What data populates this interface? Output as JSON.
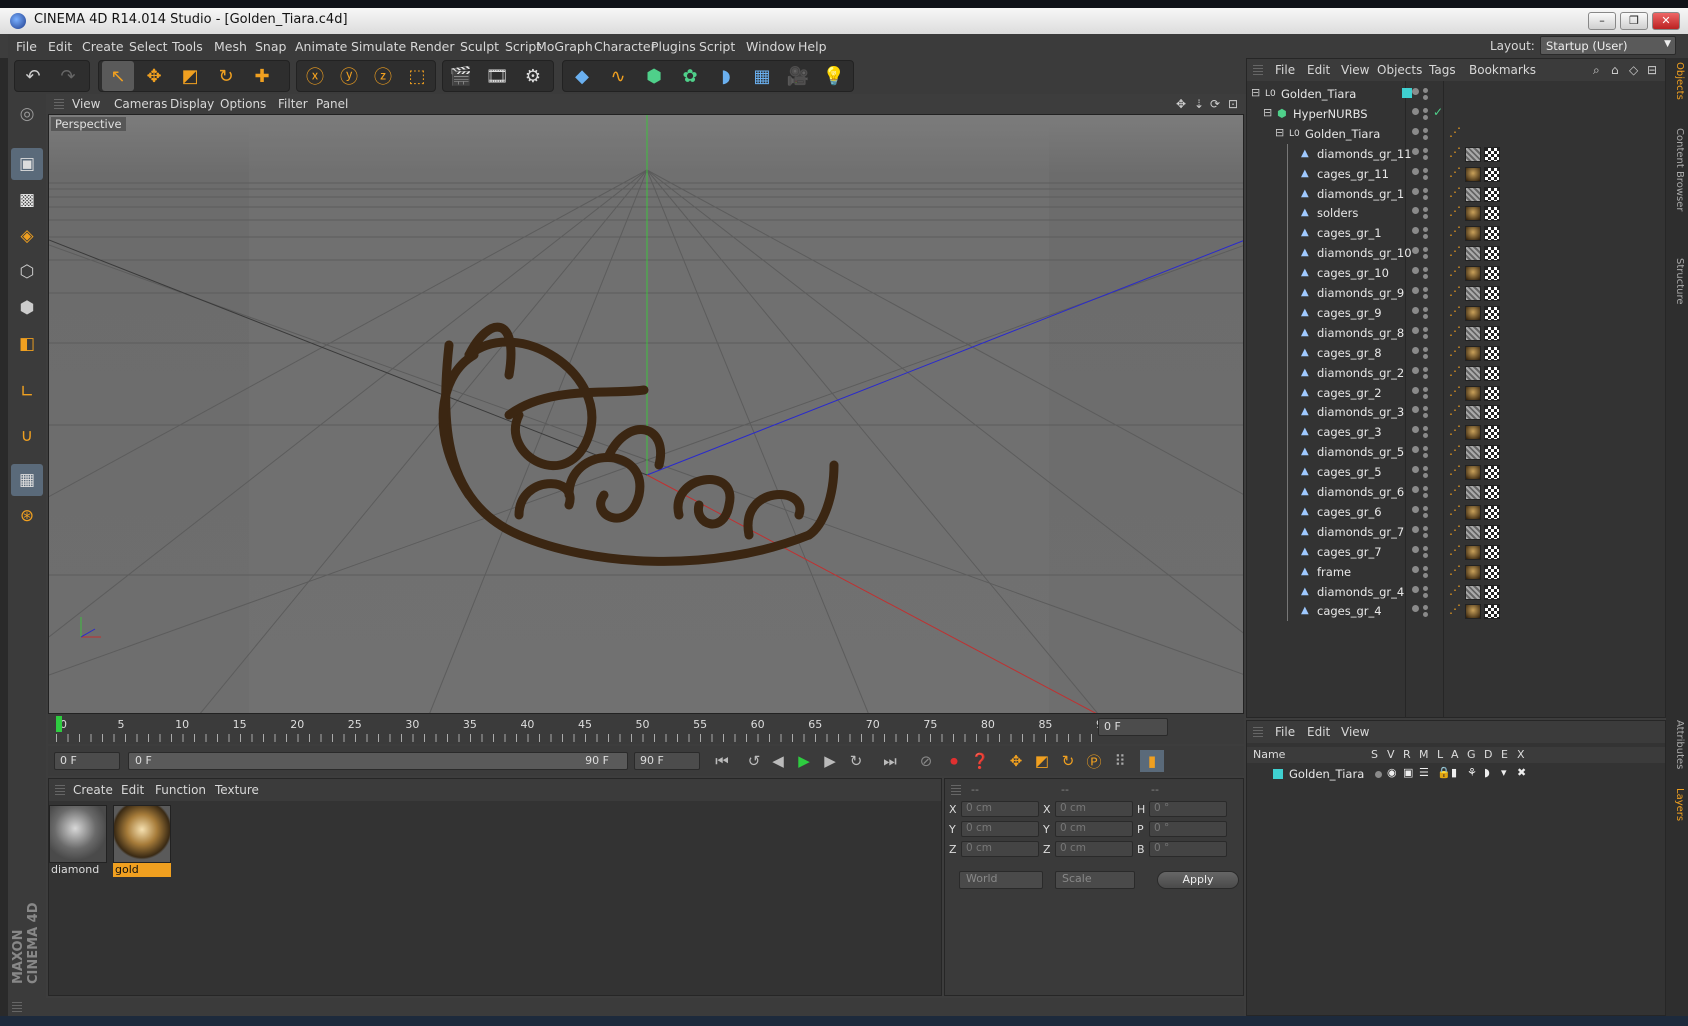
{
  "window": {
    "title": "CINEMA 4D R14.014 Studio - [Golden_Tiara.c4d]"
  },
  "menubar": {
    "items": [
      "File",
      "Edit",
      "Create",
      "Select",
      "Tools",
      "Mesh",
      "Snap",
      "Animate",
      "Simulate",
      "Render",
      "Sculpt",
      "Script",
      "MoGraph",
      "Character",
      "Plugins",
      "Script",
      "Window",
      "Help"
    ],
    "layout_label": "Layout:",
    "layout_value": "Startup (User)"
  },
  "toolbar": {
    "icons": [
      "undo-icon",
      "redo-icon",
      "live-selection-icon",
      "move-icon",
      "scale-icon",
      "rotate-icon",
      "add-icon",
      "x-axis-icon",
      "y-axis-icon",
      "z-axis-icon",
      "coordinate-system-icon",
      "render-view-icon",
      "render-picture-viewer-icon",
      "render-settings-icon",
      "cube-icon",
      "spline-icon",
      "nurbs-icon",
      "array-icon",
      "deformer-icon",
      "floor-icon",
      "camera-icon",
      "light-icon"
    ]
  },
  "viewport": {
    "menu": [
      "View",
      "Cameras",
      "Display",
      "Options",
      "Filter",
      "Panel"
    ],
    "label": "Perspective"
  },
  "timeline": {
    "ticks": [
      "0",
      "5",
      "10",
      "15",
      "20",
      "25",
      "30",
      "35",
      "40",
      "45",
      "50",
      "55",
      "60",
      "65",
      "70",
      "75",
      "80",
      "85",
      "90"
    ],
    "current_frame": "0 F"
  },
  "transport": {
    "start_field": "0 F",
    "range_start": "0 F",
    "range_end": "90 F",
    "end_field": "90 F"
  },
  "material_manager": {
    "menu": [
      "Create",
      "Edit",
      "Function",
      "Texture"
    ],
    "materials": [
      {
        "name": "diamond",
        "selected": false
      },
      {
        "name": "gold",
        "selected": true
      }
    ]
  },
  "coordinates": {
    "headers": [
      "--",
      "--",
      "--"
    ],
    "rows": [
      {
        "a": "X",
        "av": "0 cm",
        "b": "X",
        "bv": "0 cm",
        "c": "H",
        "cv": "0 °"
      },
      {
        "a": "Y",
        "av": "0 cm",
        "b": "Y",
        "bv": "0 cm",
        "c": "P",
        "cv": "0 °"
      },
      {
        "a": "Z",
        "av": "0 cm",
        "b": "Z",
        "bv": "0 cm",
        "c": "B",
        "cv": "0 °"
      }
    ],
    "mode": "World",
    "scale": "Scale",
    "apply": "Apply"
  },
  "object_manager": {
    "menu": [
      "File",
      "Edit",
      "View",
      "Objects",
      "Tags",
      "Bookmarks"
    ],
    "objects": [
      {
        "name": "Golden_Tiara",
        "level": 0,
        "type": "null"
      },
      {
        "name": "HyperNURBS",
        "level": 1,
        "type": "nurbs"
      },
      {
        "name": "Golden_Tiara",
        "level": 2,
        "type": "null"
      },
      {
        "name": "diamonds_gr_11",
        "level": 3,
        "type": "mesh",
        "mat": "diamond"
      },
      {
        "name": "cages_gr_11",
        "level": 3,
        "type": "mesh",
        "mat": "gold"
      },
      {
        "name": "diamonds_gr_1",
        "level": 3,
        "type": "mesh",
        "mat": "diamond"
      },
      {
        "name": "solders",
        "level": 3,
        "type": "mesh",
        "mat": "gold"
      },
      {
        "name": "cages_gr_1",
        "level": 3,
        "type": "mesh",
        "mat": "gold"
      },
      {
        "name": "diamonds_gr_10",
        "level": 3,
        "type": "mesh",
        "mat": "diamond"
      },
      {
        "name": "cages_gr_10",
        "level": 3,
        "type": "mesh",
        "mat": "gold"
      },
      {
        "name": "diamonds_gr_9",
        "level": 3,
        "type": "mesh",
        "mat": "diamond"
      },
      {
        "name": "cages_gr_9",
        "level": 3,
        "type": "mesh",
        "mat": "gold"
      },
      {
        "name": "diamonds_gr_8",
        "level": 3,
        "type": "mesh",
        "mat": "diamond"
      },
      {
        "name": "cages_gr_8",
        "level": 3,
        "type": "mesh",
        "mat": "gold"
      },
      {
        "name": "diamonds_gr_2",
        "level": 3,
        "type": "mesh",
        "mat": "diamond"
      },
      {
        "name": "cages_gr_2",
        "level": 3,
        "type": "mesh",
        "mat": "gold"
      },
      {
        "name": "diamonds_gr_3",
        "level": 3,
        "type": "mesh",
        "mat": "diamond"
      },
      {
        "name": "cages_gr_3",
        "level": 3,
        "type": "mesh",
        "mat": "gold"
      },
      {
        "name": "diamonds_gr_5",
        "level": 3,
        "type": "mesh",
        "mat": "diamond"
      },
      {
        "name": "cages_gr_5",
        "level": 3,
        "type": "mesh",
        "mat": "gold"
      },
      {
        "name": "diamonds_gr_6",
        "level": 3,
        "type": "mesh",
        "mat": "diamond"
      },
      {
        "name": "cages_gr_6",
        "level": 3,
        "type": "mesh",
        "mat": "gold"
      },
      {
        "name": "diamonds_gr_7",
        "level": 3,
        "type": "mesh",
        "mat": "diamond"
      },
      {
        "name": "cages_gr_7",
        "level": 3,
        "type": "mesh",
        "mat": "gold"
      },
      {
        "name": "frame",
        "level": 3,
        "type": "mesh",
        "mat": "gold"
      },
      {
        "name": "diamonds_gr_4",
        "level": 3,
        "type": "mesh",
        "mat": "diamond"
      },
      {
        "name": "cages_gr_4",
        "level": 3,
        "type": "mesh",
        "mat": "gold"
      }
    ]
  },
  "layer_manager": {
    "menu": [
      "File",
      "Edit",
      "View"
    ],
    "columns": [
      "Name",
      "S",
      "V",
      "R",
      "M",
      "L",
      "A",
      "G",
      "D",
      "E",
      "X"
    ],
    "layers": [
      {
        "name": "Golden_Tiara",
        "color": "#3fd0d0"
      }
    ]
  },
  "side_tabs": [
    "Objects",
    "Content Browser",
    "Structure",
    "Attributes",
    "Layers"
  ],
  "branding": {
    "logo": "MAXON CINEMA 4D"
  },
  "colors": {
    "accent": "#f0a020",
    "selected_material": "#f0a020",
    "panel_bg": "#333333",
    "grid": "#5a5a5a"
  }
}
